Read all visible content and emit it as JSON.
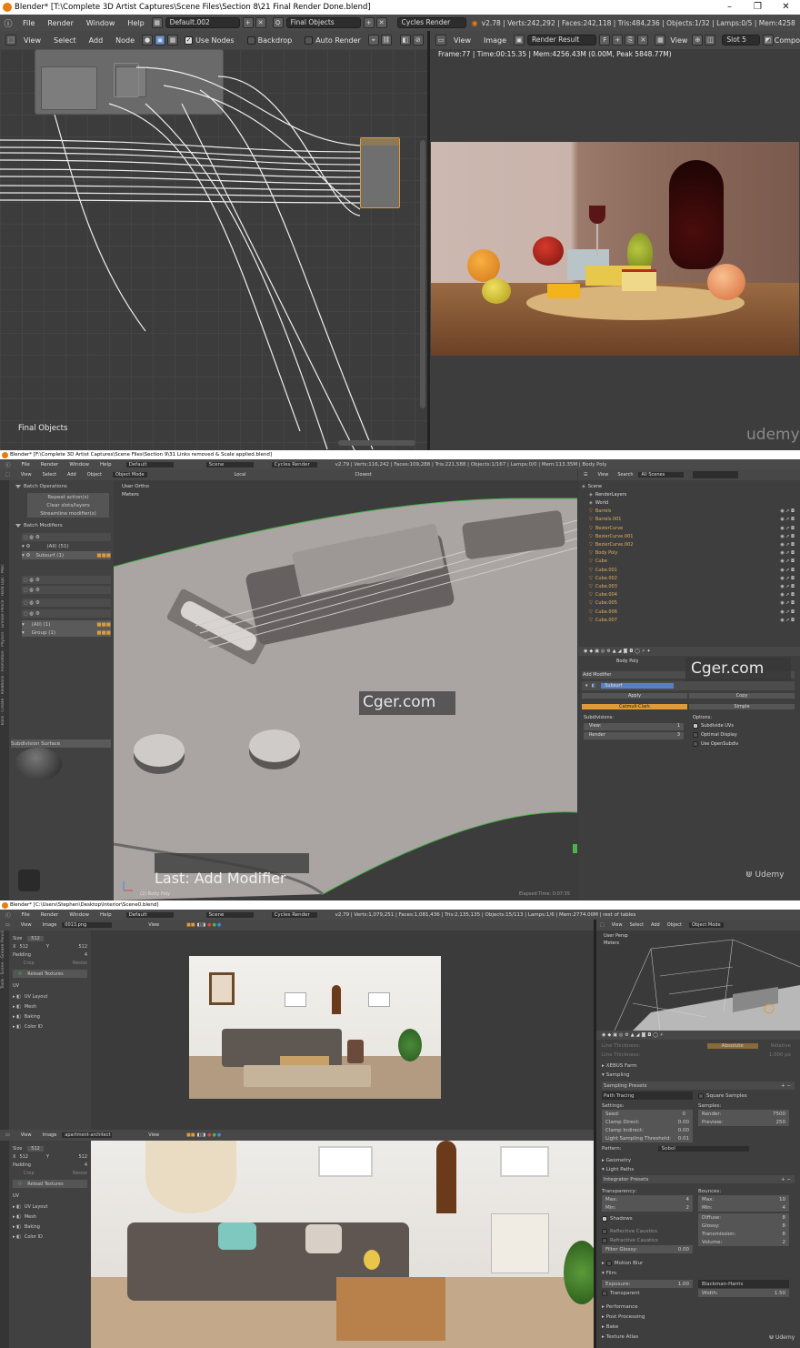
{
  "w1": {
    "title": "Blender* [T:\\Complete 3D Artist Captures\\Scene Files\\Section 8\\21 Final Render Done.blend]",
    "menu": [
      "File",
      "Render",
      "Window",
      "Help"
    ],
    "layout": "Default.002",
    "scene": "Final Objects",
    "engine": "Cycles Render",
    "stats": "v2.78 | Verts:242,292 | Faces:242,118 | Tris:484,236 | Objects:1/32 | Lamps:0/5 | Mem:4258",
    "node_menu": [
      "View",
      "Select",
      "Add",
      "Node"
    ],
    "use_nodes": "Use Nodes",
    "backdrop": "Backdrop",
    "auto_render": "Auto Render",
    "image_menu": [
      "View",
      "Image"
    ],
    "render_result": "Render Result",
    "view_label": "View",
    "slot": "Slot 5",
    "compo": "Compo",
    "frame_info": "Frame:77 | Time:00:15.35 | Mem:4256.43M (0.00M, Peak 5848.77M)",
    "node_tree_name": "Final Objects",
    "watermark": "udemy",
    "window_buttons": [
      "–",
      "❐",
      "✕"
    ]
  },
  "w2": {
    "title": "Blender* [F:\\Complete 3D Artist Captures\\Scene Files\\Section 9\\31 Links removed & Scale applied.blend]",
    "menu": [
      "File",
      "Render",
      "Window",
      "Help"
    ],
    "layout": "Default",
    "scene": "Scene",
    "engine": "Cycles Render",
    "stats": "v2.79 | Verts:116,242 | Faces:109,288 | Tris:221,588 | Objects:1/167 | Lamps:0/0 | Mem:113.35M | Body Poly",
    "view_menu": [
      "View",
      "Select",
      "Add",
      "Object"
    ],
    "mode": "Object Mode",
    "pivot": "Local",
    "snap": "Closest",
    "view_label": "User Ortho",
    "units": "Meters",
    "tools": {
      "batch_ops": "Batch Operations",
      "repeat": "Repeat action(s)",
      "clear": "Clear slots/layers",
      "streamline": "Streamline modifier(s)",
      "batch_mods": "Batch Modifiers",
      "all": "(All) (51)",
      "subsurf": "Subsurf (1)",
      "all_sub": "(All) (1)",
      "group": "Group (1)",
      "subdiv_surface": "Subdivision Surface"
    },
    "left_tabs": [
      "Tools",
      "Create",
      "Relations",
      "Animation",
      "Physics",
      "Grease Pencil",
      "Hard Ops",
      "Misc",
      "Retopo",
      "Layer",
      "Retopoflow",
      "Mira"
    ],
    "outliner_menu": [
      "View",
      "Search"
    ],
    "outliner_filter": "All Scenes",
    "outliner": [
      "Scene",
      "RenderLayers",
      "World",
      "Barrels",
      "Barrels.001",
      "BezierCurve",
      "BezierCurve.001",
      "BezierCurve.002",
      "Body Poly",
      "Cube",
      "Cube.001",
      "Cube.002",
      "Cube.003",
      "Cube.004",
      "Cube.005",
      "Cube.006",
      "Cube.007"
    ],
    "props": {
      "object": "Body Poly",
      "add_modifier": "Add Modifier",
      "modifier": "Subsurf",
      "apply": "Apply",
      "copy": "Copy",
      "catmull": "Catmull-Clark",
      "simple": "Simple",
      "subdivisions": "Subdivisions:",
      "view": "View:",
      "view_val": "1",
      "render": "Render",
      "render_val": "3",
      "options": "Options:",
      "subdivide_uvs": "Subdivide UVs",
      "optimal": "Optimal Display",
      "opensubdiv": "Use OpenSubdiv"
    },
    "watermark_cger": "Cger.com",
    "last_op": "Last: Add Modifier",
    "elapsed": "Elapsed Time: 0:07:35",
    "obj_label": "(2) Body Poly",
    "udemy": "Udemy"
  },
  "w3": {
    "title": "Blender* [C:\\Users\\Stephen\\Desktop\\Interior\\Scene0.blend]",
    "menu": [
      "File",
      "Render",
      "Window",
      "Help"
    ],
    "layout": "Default",
    "scene": "Scene",
    "engine": "Cycles Render",
    "stats": "v2.79 | Verts:1,079,251 | Faces:1,081,436 | Tris:2,135,135 | Objects:15/113 | Lamps:1/6 | Mem:2774.00M | rest of tables",
    "img_menu": [
      "View",
      "Image"
    ],
    "image1": "0013.png",
    "image2": "apartment-architect",
    "view_btn": "View",
    "side": {
      "size": "Size",
      "size_val": "512",
      "x": "X",
      "x_val": "512",
      "y": "Y",
      "y_val": "512",
      "padding": "Padding",
      "padding_val": "4",
      "crop": "Crop",
      "resize": "Resize",
      "reload": "Reload Textures",
      "uv": "UV",
      "uv_layout": "UV Layout",
      "mesh": "Mesh",
      "baking": "Baking",
      "color_id": "Color ID"
    },
    "tabs_left": [
      "Tools",
      "Scene",
      "Grease Pencil"
    ],
    "vp_menu": [
      "View",
      "Select",
      "Add",
      "Object"
    ],
    "vp_mode": "Object Mode",
    "vp_label": "User Persp",
    "vp_units": "Meters",
    "render": {
      "line_thickness": "Line Thickness:",
      "absolute": "Absolute",
      "relative": "Relative",
      "line_thick_val": "1.000 px",
      "xebus": "XEBUS Farm",
      "sampling": "Sampling",
      "presets": "Sampling Presets",
      "path_tracing": "Path Tracing",
      "square": "Square Samples",
      "settings": "Settings:",
      "samples": "Samples:",
      "seed": "Seed:",
      "seed_val": "0",
      "clamp_direct": "Clamp Direct:",
      "clamp_direct_val": "0.00",
      "clamp_indirect": "Clamp Indirect:",
      "clamp_indirect_val": "0.00",
      "light_thresh": "Light Sampling Threshold:",
      "light_thresh_val": "0.01",
      "render_s": "Render:",
      "render_s_val": "7500",
      "preview": "Preview:",
      "preview_val": "250",
      "pattern": "Pattern:",
      "pattern_val": "Sobol",
      "geometry": "Geometry",
      "light_paths": "Light Paths",
      "integrator": "Integrator Presets",
      "transparency": "Transparency:",
      "bounces": "Bounces:",
      "max": "Max:",
      "max_val": "4",
      "min": "Min:",
      "min_val": "2",
      "b_max_val": "10",
      "b_min_val": "4",
      "shadows": "Shadows",
      "diffuse": "Diffuse:",
      "diffuse_val": "8",
      "glossy": "Glossy:",
      "glossy_val": "8",
      "transmission": "Transmission:",
      "transmission_val": "8",
      "volume": "Volume:",
      "volume_val": "2",
      "refl_caustics": "Reflective Caustics",
      "refr_caustics": "Refractive Caustics",
      "filter_glossy": "Filter Glossy:",
      "filter_glossy_val": "0.00",
      "motion_blur": "Motion Blur",
      "film": "Film",
      "exposure": "Exposure:",
      "exposure_val": "1.00",
      "filter_type": "Blackman-Harris",
      "transparent": "Transparent",
      "width": "Width:",
      "width_val": "1.50",
      "performance": "Performance",
      "post": "Post Processing",
      "bake": "Bake",
      "texture_atlas": "Texture Atlas"
    },
    "udemy": "Udemy"
  },
  "colors": {
    "accent": "#5680c2",
    "orange": "#e09a36",
    "blender_bg": "#393939",
    "header": "#474747"
  }
}
